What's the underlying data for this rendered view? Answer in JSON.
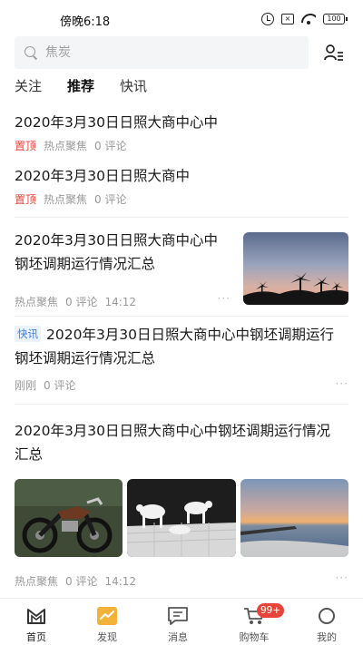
{
  "status_bar": {
    "time": "傍晚6:18",
    "battery": "100",
    "box_glyph": "×"
  },
  "search": {
    "placeholder": "焦炭"
  },
  "tabs": [
    {
      "label": "关注",
      "active": false
    },
    {
      "label": "推荐",
      "active": true
    },
    {
      "label": "快讯",
      "active": false
    }
  ],
  "feed": [
    {
      "title": "2020年3月30日日照大商中心中",
      "pin": "置顶",
      "source": "热点聚焦",
      "comments": "0 评论"
    },
    {
      "title": "2020年3月30日日照大商中",
      "pin": "置顶",
      "source": "热点聚焦",
      "comments": "0 评论"
    },
    {
      "title_line1": "2020年3月30日日照大商中心中",
      "title_line2": "钢坯调期运行情况汇总",
      "source": "热点聚焦",
      "comments": "0 评论",
      "time": "14:12",
      "image": "sunset-palms-photo"
    },
    {
      "badge": "快讯",
      "title_line1": "2020年3月30日日照大商中心中钢坯调期运行",
      "title_line2": "钢坯调期运行情况汇总",
      "source": "刚刚",
      "comments": "0 评论"
    },
    {
      "title_line1": "2020年3月30日日照大商中心中钢坯调期运行情况",
      "title_line2": "汇总",
      "images": [
        "motorcycle-photo",
        "cow-figurines-photo",
        "seaside-sunset-photo"
      ],
      "source": "热点聚焦",
      "comments": "0 评论",
      "time": "14:12"
    }
  ],
  "more_dots": "···",
  "bottom_nav": [
    {
      "label": "首页",
      "icon": "home-m-icon",
      "active": true
    },
    {
      "label": "发现",
      "icon": "discover-icon",
      "active": false
    },
    {
      "label": "消息",
      "icon": "message-icon",
      "active": false
    },
    {
      "label": "购物车",
      "icon": "cart-icon",
      "active": false,
      "badge": "99+"
    },
    {
      "label": "我的",
      "icon": "profile-icon",
      "active": false
    }
  ],
  "colors": {
    "pin": "#e8443a",
    "flash": "#3b80d6",
    "accent": "#f2b23a"
  }
}
